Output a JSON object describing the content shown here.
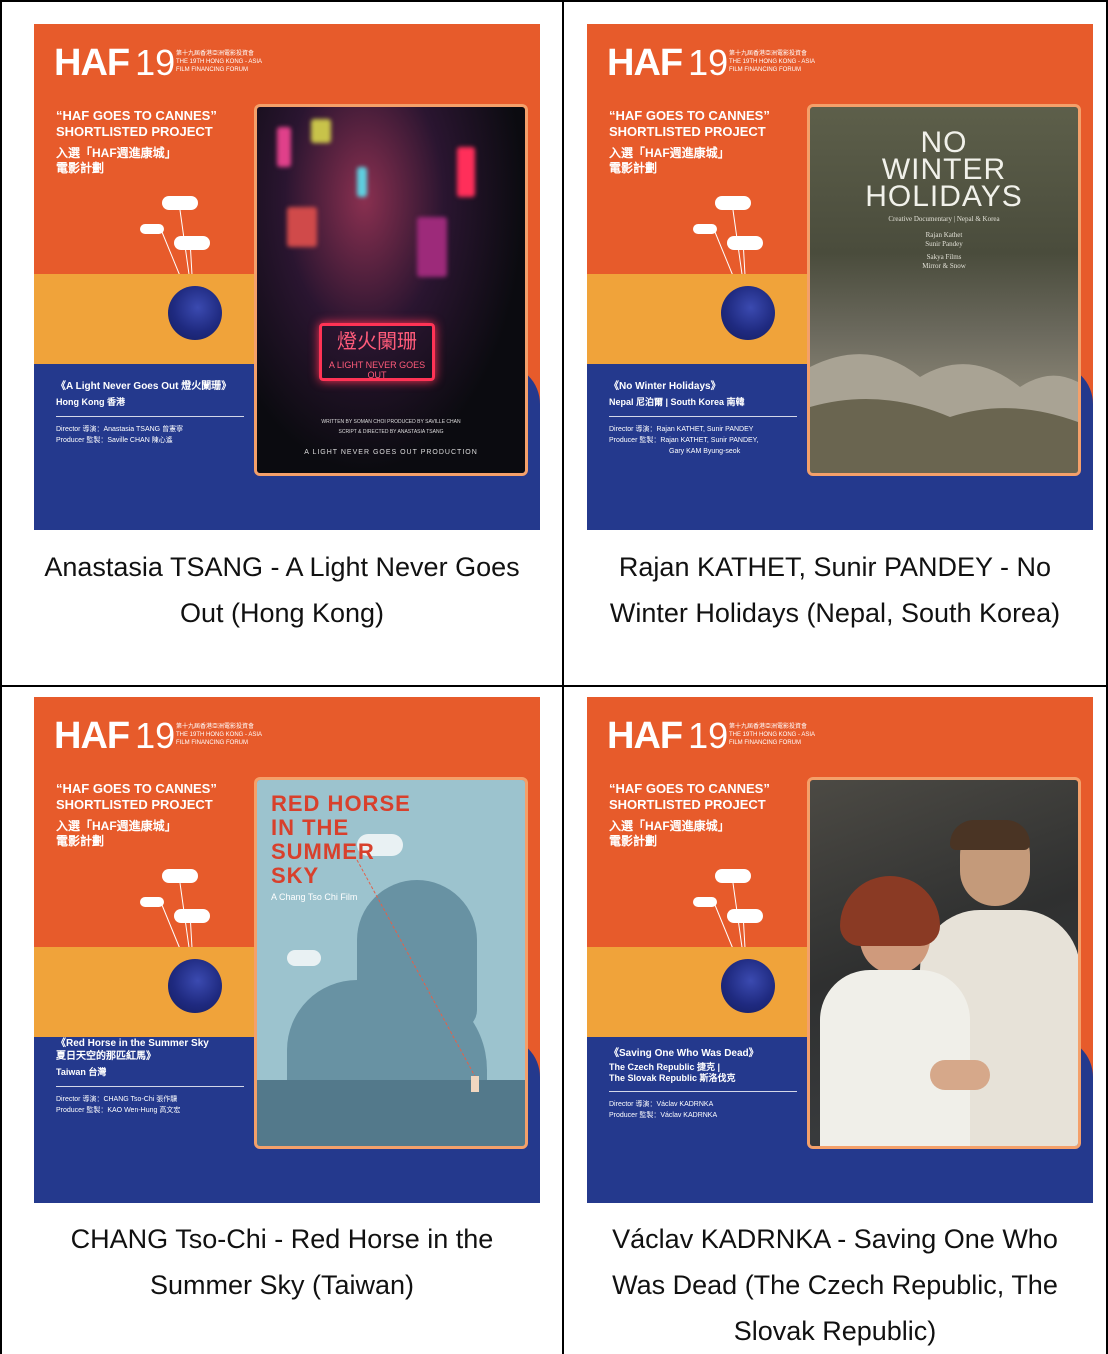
{
  "posters": [
    {
      "haf_logo": "HAF",
      "haf_number": "19",
      "logo_subtitle_zh": "第十九屆香港亞洲電影投資會",
      "logo_subtitle_en_1": "THE 19TH HONG KONG - ASIA",
      "logo_subtitle_en_2": "FILM FINANCING FORUM",
      "shortlist_en_1": "“HAF GOES TO CANNES”",
      "shortlist_en_2": "SHORTLISTED PROJECT",
      "shortlist_zh_1": "入選「HAF週進康城」",
      "shortlist_zh_2": "電影計劃",
      "film_title": "《A Light Never Goes Out 燈火闌珊》",
      "country": "Hong Kong 香港",
      "director": "Director 導演：Anastasia TSANG 曾憲寧",
      "producer": "Producer 監製：Saville CHAN 陳心遙",
      "art": {
        "sign_text": "燈火闌珊",
        "sign_sub": "A LIGHT NEVER GOES OUT",
        "credit_1": "WRITTEN BY SOMAN CHOI  PRODUCED BY SAVILLE CHAN",
        "credit_2": "SCRIPT & DIRECTED BY ANASTASIA TSANG",
        "credit_3": "A LIGHT NEVER GOES OUT PRODUCTION"
      }
    },
    {
      "haf_logo": "HAF",
      "haf_number": "19",
      "logo_subtitle_zh": "第十九屆香港亞洲電影投資會",
      "logo_subtitle_en_1": "THE 19TH HONG KONG - ASIA",
      "logo_subtitle_en_2": "FILM FINANCING FORUM",
      "shortlist_en_1": "“HAF GOES TO CANNES”",
      "shortlist_en_2": "SHORTLISTED PROJECT",
      "shortlist_zh_1": "入選「HAF週進康城」",
      "shortlist_zh_2": "電影計劃",
      "film_title": "《No Winter Holidays》",
      "country": "Nepal 尼泊爾  |  South Korea 南韓",
      "director": "Director 導演：Rajan KATHET, Sunir PANDEY",
      "producer": "Producer 監製：Rajan KATHET, Sunir PANDEY,",
      "producer_2": "Gary KAM Byung-seok",
      "art": {
        "title_1": "NO",
        "title_2": "WINTER",
        "title_3": "HOLIDAYS",
        "tagline": "Creative Documentary  |  Nepal & Korea",
        "names_1": "Rajan Kathet",
        "names_2": "Sunir Pandey",
        "names_3": "Sakya Films",
        "names_4": "Mirror & Snow"
      }
    },
    {
      "haf_logo": "HAF",
      "haf_number": "19",
      "logo_subtitle_zh": "第十九屆香港亞洲電影投資會",
      "logo_subtitle_en_1": "THE 19TH HONG KONG - ASIA",
      "logo_subtitle_en_2": "FILM FINANCING FORUM",
      "shortlist_en_1": "“HAF GOES TO CANNES”",
      "shortlist_en_2": "SHORTLISTED PROJECT",
      "shortlist_zh_1": "入選「HAF週進康城」",
      "shortlist_zh_2": "電影計劃",
      "film_title": "《Red Horse in the Summer Sky",
      "film_title_zh": "夏日天空的那匹紅馬》",
      "country": "Taiwan 台灣",
      "director": "Director 導演：CHANG Tso-Chi 張作驥",
      "producer": "Producer 監製：KAO Wen-Hung 高文宏",
      "art": {
        "title_1": "RED HORSE",
        "title_2": "IN THE",
        "title_3": "SUMMER",
        "title_4": "SKY",
        "subtitle": "A Chang Tso Chi Film"
      }
    },
    {
      "haf_logo": "HAF",
      "haf_number": "19",
      "logo_subtitle_zh": "第十九屆香港亞洲電影投資會",
      "logo_subtitle_en_1": "THE 19TH HONG KONG - ASIA",
      "logo_subtitle_en_2": "FILM FINANCING FORUM",
      "shortlist_en_1": "“HAF GOES TO CANNES”",
      "shortlist_en_2": "SHORTLISTED PROJECT",
      "shortlist_zh_1": "入選「HAF週進康城」",
      "shortlist_zh_2": "電影計劃",
      "film_title": "《Saving One Who Was Dead》",
      "country": "The Czech Republic 捷克  |",
      "country_2": "The Slovak Republic 斯洛伐克",
      "director": "Director 導演：Václav KADRNKA",
      "producer": "Producer 監製：Václav KADRNKA"
    }
  ],
  "captions": [
    [
      "Anastasia TSANG - A Light Never Goes",
      "Out (Hong Kong)"
    ],
    [
      "Rajan KATHET, Sunir PANDEY - No",
      "Winter Holidays (Nepal, South Korea)"
    ],
    [
      "CHANG Tso-Chi - Red Horse in the",
      "Summer Sky (Taiwan)"
    ],
    [
      "Václav KADRNKA - Saving One Who",
      "Was Dead (The Czech Republic, The",
      "Slovak Republic)"
    ]
  ],
  "colors": {
    "poster_orange": "#e75b2b",
    "poster_blue": "#24398d",
    "poster_yellow": "#f0a33a",
    "table_border": "#000000"
  }
}
